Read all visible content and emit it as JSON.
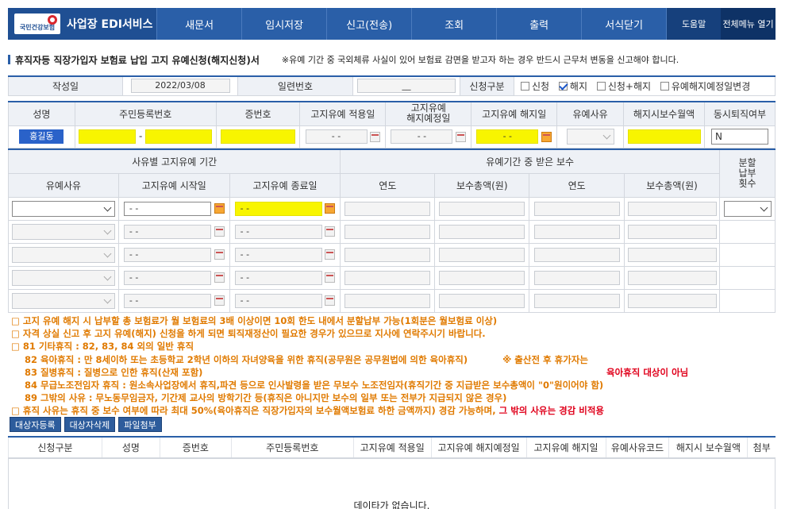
{
  "app": {
    "logo_text": "국민건강보험",
    "service_name": "사업장 EDI서비스"
  },
  "nav": {
    "items": [
      "새문서",
      "임시저장",
      "신고(전송)",
      "조회",
      "출력",
      "서식닫기"
    ],
    "help": "도움말",
    "all_menu": "전체메뉴 열기"
  },
  "page": {
    "title": "휴직자등 직장가입자 보험료 납입 고지 유예신청(해지신청)서",
    "notice": "※유예 기간 중 국외체류 사실이 있어 보험료 감면을 받고자 하는 경우 반드시 근무처 변동을 신고해야 합니다."
  },
  "form_header": {
    "date_label": "작성일",
    "date_value": "2022/03/08",
    "serial_label": "일련번호",
    "serial_value": "__",
    "type_label": "신청구분",
    "options": [
      {
        "label": "신청",
        "checked": false
      },
      {
        "label": "해지",
        "checked": true
      },
      {
        "label": "신청+해지",
        "checked": false
      },
      {
        "label": "유예해지예정일변경",
        "checked": false
      }
    ]
  },
  "person_table": {
    "headers": [
      "성명",
      "주민등록번호",
      "증번호",
      "고지유예 적용일",
      "고지유예\n해지예정일",
      "고지유예 해지일",
      "유예사유",
      "해지시보수월액",
      "동시퇴직여부"
    ],
    "name_value": "홍길동",
    "rrn_sep": "-",
    "date_placeholder": "- -",
    "retire_value": "N"
  },
  "period_table": {
    "group1": "사유별 고지유예 기간",
    "group2": "유예기간 중 받은 보수",
    "installment": "분할\n납부\n횟수",
    "cols": [
      "유예사유",
      "고지유예 시작일",
      "고지유예 종료일",
      "연도",
      "보수총액(원)",
      "연도",
      "보수총액(원)"
    ],
    "date_placeholder": "- -"
  },
  "notes": [
    "□ 고지 유예 해지 시 납부할 총 보험료가 월 보험료의 3배 이상이면 10회 한도 내에서 분할납부 가능(1회분은 월보험료 이상)",
    "□ 자격 상실 신고 후 고지 유예(해지) 신청을 하게 되면 퇴직재정산이 필요한 경우가 있으므로 지사에 연락주시기 바랍니다.",
    "□ 81 기타휴직 : 82, 83, 84 외의 일반 휴직",
    "82 육아휴직 : 만 8세이하 또는 초등학교 2학년 이하의 자녀양육을 위한 휴직(공무원은 공무원법에 의한 육아휴직)",
    "※ 출산전 후 휴가자는",
    "육아휴직 대상이 아님",
    "83 질병휴직 : 질병으로 인한 휴직(산재 포함)",
    "84 무급노조전임자 휴직 : 원소속사업장에서 휴직,파견 등으로 인사발령을 받은 무보수 노조전임자(휴직기간 중 지급받은 보수총액이 \"0\"원이어야 함)",
    "89 그밖의 사유 : 무노동무임금자, 기간제 교사의 방학기간 등(휴직은 아니지만 보수의 일부 또는 전부가 지급되지 않은 경우)",
    "□ 휴직 사유는 휴직 중 보수 여부에 따라 최대 50%(육아휴직은 직장가입자의 보수월액보험료 하한 금액까지) 경감 가능하며,",
    "그 밖의 사유는 경감 비적용"
  ],
  "buttons": [
    "대상자등록",
    "대상자삭제",
    "파일첨부"
  ],
  "grid": {
    "headers": [
      "신청구분",
      "성명",
      "증번호",
      "주민등록번호",
      "고지유예 적용일",
      "고지유예 해지예정일",
      "고지유예 해지일",
      "유예사유코드",
      "해지시 보수월액",
      "첨부"
    ],
    "empty_text": "데이타가 없습니다."
  },
  "colors": {
    "nav": "#2a5fa8",
    "highlight": "#f8f500",
    "note_orange": "#e07a00",
    "note_red": "#e0001b"
  }
}
